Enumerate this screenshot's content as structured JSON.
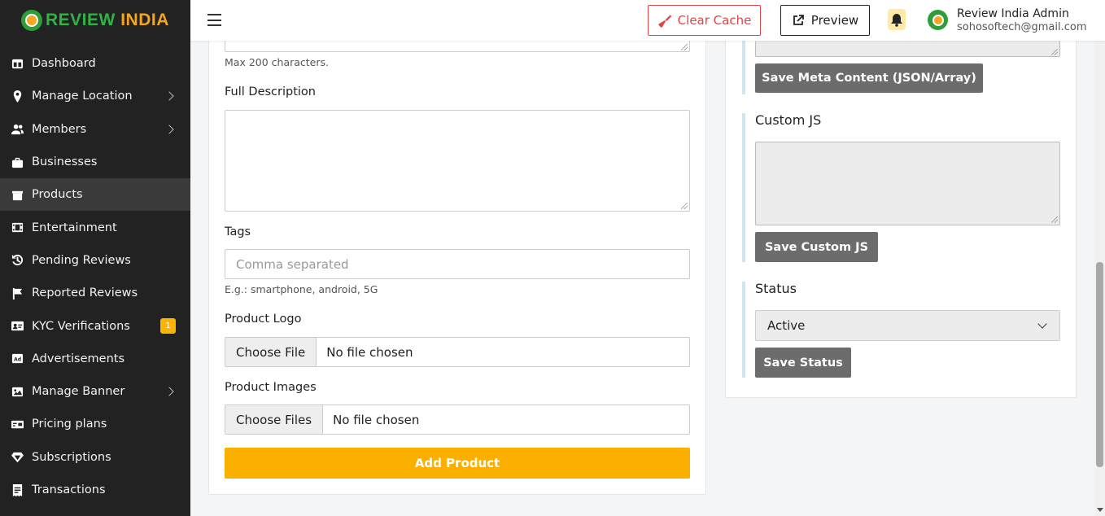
{
  "brand": {
    "part1": "REVIEW",
    "part2": "INDIA"
  },
  "sidebar": {
    "items": [
      {
        "label": "Dashboard",
        "icon": "dashboard-icon",
        "chevron": false
      },
      {
        "label": "Manage Location",
        "icon": "location-pin-icon",
        "chevron": true
      },
      {
        "label": "Members",
        "icon": "users-icon",
        "chevron": true
      },
      {
        "label": "Businesses",
        "icon": "briefcase-icon",
        "chevron": false
      },
      {
        "label": "Products",
        "icon": "box-icon",
        "chevron": false,
        "active": true
      },
      {
        "label": "Entertainment",
        "icon": "film-icon",
        "chevron": false
      },
      {
        "label": "Pending Reviews",
        "icon": "history-icon",
        "chevron": false
      },
      {
        "label": "Reported Reviews",
        "icon": "flag-icon",
        "chevron": false
      },
      {
        "label": "KYC Verifications",
        "icon": "id-card-icon",
        "chevron": false,
        "badge": "1"
      },
      {
        "label": "Advertisements",
        "icon": "ad-icon",
        "chevron": false
      },
      {
        "label": "Manage Banner",
        "icon": "image-icon",
        "chevron": true
      },
      {
        "label": "Pricing plans",
        "icon": "money-bill-icon",
        "chevron": false
      },
      {
        "label": "Subscriptions",
        "icon": "gem-icon",
        "chevron": false
      },
      {
        "label": "Transactions",
        "icon": "receipt-icon",
        "chevron": false
      }
    ]
  },
  "topbar": {
    "clear_cache": "Clear Cache",
    "preview": "Preview",
    "user_name": "Review India Admin",
    "user_email": "sohosoftech@gmail.com"
  },
  "form": {
    "short_desc_help": "Max 200 characters.",
    "full_desc_label": "Full Description",
    "tags_label": "Tags",
    "tags_placeholder": "Comma separated",
    "tags_help": "E.g.: smartphone, android, 5G",
    "logo_label": "Product Logo",
    "logo_button": "Choose File",
    "logo_status": "No file chosen",
    "images_label": "Product Images",
    "images_button": "Choose Files",
    "images_status": "No file chosen",
    "submit": "Add Product"
  },
  "side_panel": {
    "save_meta": "Save Meta Content (JSON/Array)",
    "custom_js_label": "Custom JS",
    "save_js": "Save Custom JS",
    "status_label": "Status",
    "status_value": "Active",
    "save_status": "Save Status"
  },
  "colors": {
    "sidebar_bg": "#222222",
    "accent_yellow": "#fbb000",
    "danger": "#e04444",
    "brand_green": "#2fb344",
    "brand_orange": "#f7a41d"
  }
}
